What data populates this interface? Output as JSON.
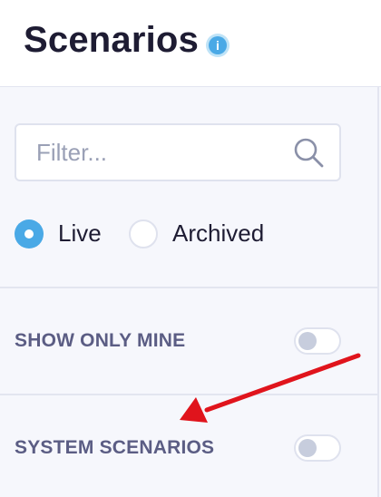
{
  "header": {
    "title": "Scenarios",
    "info_icon": "info-icon",
    "info_glyph": "i"
  },
  "filter": {
    "placeholder": "Filter...",
    "value": "",
    "icon": "search-icon"
  },
  "status_filter": {
    "options": [
      {
        "label": "Live",
        "checked": true
      },
      {
        "label": "Archived",
        "checked": false
      }
    ]
  },
  "toggles": [
    {
      "label": "SHOW ONLY MINE",
      "on": false
    },
    {
      "label": "SYSTEM SCENARIOS",
      "on": false
    }
  ],
  "annotation": {
    "arrow_color": "#e0141c"
  },
  "colors": {
    "accent": "#4aa9e6",
    "title": "#1e1c33",
    "toggle_label": "#5b5d84",
    "background": "#f6f7fc"
  }
}
